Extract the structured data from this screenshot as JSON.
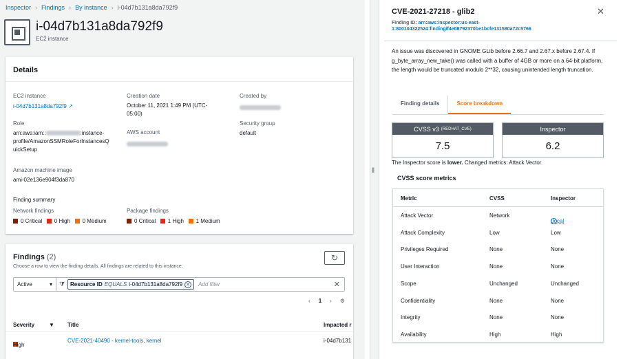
{
  "breadcrumbs": [
    "Inspector",
    "Findings",
    "By instance",
    "i-04d7b131a8da792f9"
  ],
  "instance": {
    "title": "i-04d7b131a8da792f9",
    "subtitle": "EC2 instance"
  },
  "details": {
    "heading": "Details",
    "ec2_label": "EC2 instance",
    "ec2_value": "i-04d7b131a8da792f9",
    "creation_label": "Creation date",
    "creation_value_1": "October 11, 2021 1:49 PM (UTC-",
    "creation_value_2": "05:00)",
    "created_by_label": "Created by",
    "role_label": "Role",
    "role_l1_prefix": "arn:aws:iam::",
    "role_l1_suffix": ":instance-",
    "role_l2": "profile/AmazonSSMRoleForInstancesQ",
    "role_l3": "uickSetup",
    "account_label": "AWS account",
    "sg_label": "Security group",
    "sg_value": "default",
    "ami_label": "Amazon machine image",
    "ami_value": "ami-02e136e904f3da870",
    "summary_label": "Finding summary",
    "network_label": "Network findings",
    "network": [
      {
        "label": "0 Critical",
        "color": "#7d2105"
      },
      {
        "label": "0 High",
        "color": "#d13212"
      },
      {
        "label": "0 Medium",
        "color": "#ec7211"
      }
    ],
    "package_label": "Package findings",
    "package": [
      {
        "label": "0 Critical",
        "color": "#7d2105"
      },
      {
        "label": "1 High",
        "color": "#d13212"
      },
      {
        "label": "1 Medium",
        "color": "#ec7211"
      }
    ]
  },
  "findings": {
    "title": "Findings",
    "count": "(2)",
    "description": "Choose a row to view the finding details. All findings are related to this instance.",
    "status_select": "Active",
    "token_key": "Resource ID",
    "token_op": "EQUALS",
    "token_value": "i-04d7b131a8da792f9",
    "add_filter_placeholder": "Add filter",
    "page": "1",
    "columns": {
      "severity": "Severity",
      "title": "Title",
      "impacted": "Impacted r"
    },
    "row": {
      "severity": "High",
      "title": "CVE-2021-40490 - kernel-tools, kernel",
      "impacted": "i-04d7b131"
    }
  },
  "panel": {
    "title": "CVE-2021-27218 - glib2",
    "finding_id_label": "Finding ID:",
    "finding_id": "arn:aws:inspector:us-east-1:800104322524:finding/f4e08792370be1bcfe131580a72c5766",
    "description": "An issue was discovered in GNOME GLib before 2.66.7 and 2.67.x before 2.67.4. If g_byte_array_new_take() was called with a buffer of 4GB or more on a 64-bit platform, the length would be truncated modulo 2**32, causing unintended length truncation.",
    "tabs": [
      "Finding details",
      "Score breakdown"
    ],
    "cvss_label": "CVSS v3",
    "cvss_source": "(REDHAT_CVE)",
    "cvss_score": "7.5",
    "inspector_label": "Inspector",
    "inspector_score": "6.2",
    "compare_prefix": "The Inspector score is ",
    "compare_word": "lower.",
    "compare_suffix": " Changed metrics: Attack Vector",
    "metrics_heading": "CVSS score metrics",
    "metric_columns": [
      "Metric",
      "CVSS",
      "Inspector"
    ],
    "metrics": [
      {
        "metric": "Attack Vector",
        "cvss": "Network",
        "inspector": "Local"
      },
      {
        "metric": "Attack Complexity",
        "cvss": "Low",
        "inspector": "Low"
      },
      {
        "metric": "Privileges Required",
        "cvss": "None",
        "inspector": "None"
      },
      {
        "metric": "User Interaction",
        "cvss": "None",
        "inspector": "None"
      },
      {
        "metric": "Scope",
        "cvss": "Unchanged",
        "inspector": "Unchanged"
      },
      {
        "metric": "Confidentiality",
        "cvss": "None",
        "inspector": "None"
      },
      {
        "metric": "Integrity",
        "cvss": "None",
        "inspector": "None"
      },
      {
        "metric": "Availability",
        "cvss": "High",
        "inspector": "High"
      }
    ]
  },
  "colors": {
    "link": "#0073bb",
    "accent": "#ec7211",
    "high": "#d13212"
  }
}
